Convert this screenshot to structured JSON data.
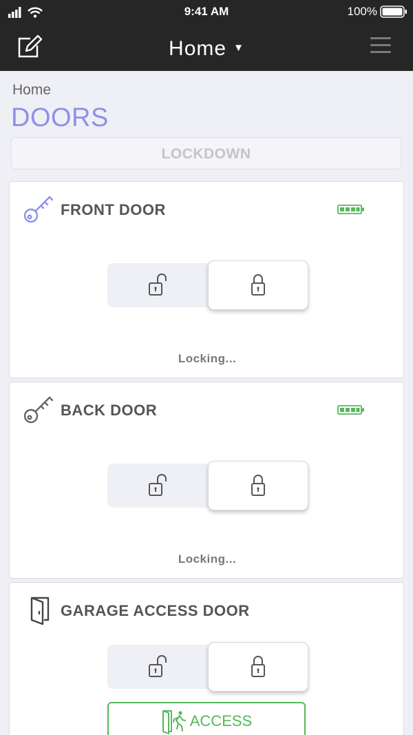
{
  "status_bar": {
    "time": "9:41 AM",
    "battery_percent": "100%"
  },
  "nav": {
    "title": "Home",
    "caret": "▼"
  },
  "breadcrumb": "Home",
  "page_title": "DOORS",
  "lockdown_label": "LOCKDOWN",
  "colors": {
    "accent": "#8e90ea",
    "battery_green": "#55b85a",
    "nav_bg": "#262626"
  },
  "doors": [
    {
      "name": "FRONT DOOR",
      "icon": "key-icon",
      "icon_color": "#8e90ea",
      "battery": "full",
      "lock_state": "locked",
      "status": "Locking..."
    },
    {
      "name": "BACK DOOR",
      "icon": "key-icon",
      "icon_color": "#666666",
      "battery": "full",
      "lock_state": "locked",
      "status": "Locking..."
    },
    {
      "name": "GARAGE ACCESS DOOR",
      "icon": "door-icon",
      "icon_color": "#444444",
      "lock_state": "locked",
      "access_label": "ACCESS"
    }
  ]
}
